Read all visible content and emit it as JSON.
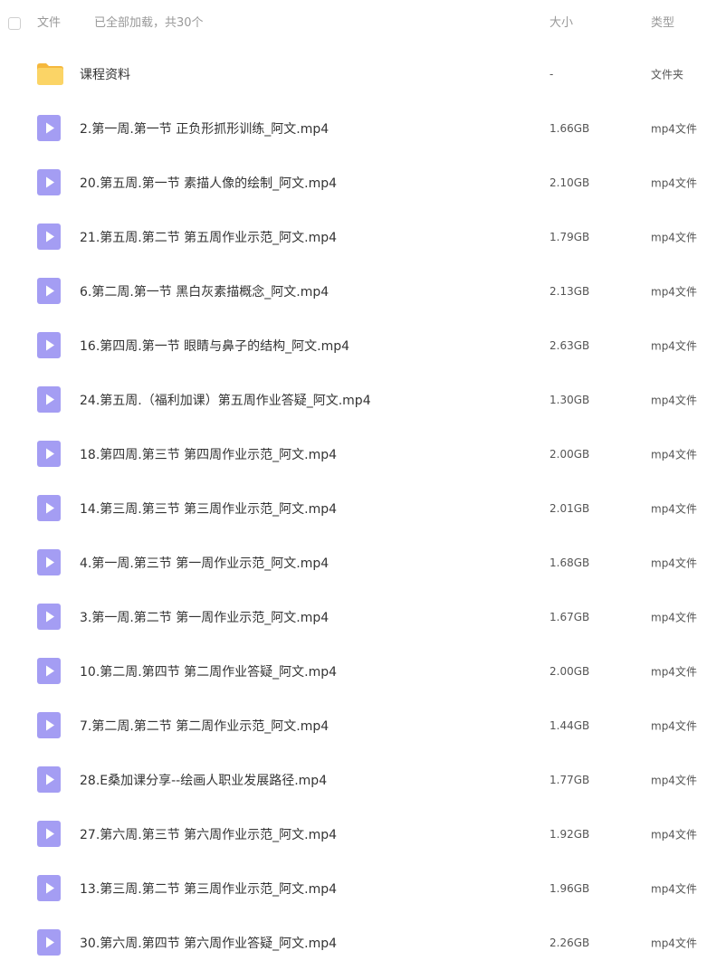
{
  "header": {
    "col_file": "文件",
    "load_status": "已全部加载，共30个",
    "col_size": "大小",
    "col_type": "类型"
  },
  "colors": {
    "video_icon": "#a49df3",
    "folder_icon": "#fbd466",
    "header_text": "#999999"
  },
  "files": [
    {
      "icon": "folder-icon",
      "name": "课程资料",
      "size": "-",
      "type": "文件夹"
    },
    {
      "icon": "video-file-icon",
      "name": "2.第一周.第一节 正负形抓形训练_阿文.mp4",
      "size": "1.66GB",
      "type": "mp4文件"
    },
    {
      "icon": "video-file-icon",
      "name": "20.第五周.第一节 素描人像的绘制_阿文.mp4",
      "size": "2.10GB",
      "type": "mp4文件"
    },
    {
      "icon": "video-file-icon",
      "name": "21.第五周.第二节 第五周作业示范_阿文.mp4",
      "size": "1.79GB",
      "type": "mp4文件"
    },
    {
      "icon": "video-file-icon",
      "name": "6.第二周.第一节 黑白灰素描概念_阿文.mp4",
      "size": "2.13GB",
      "type": "mp4文件"
    },
    {
      "icon": "video-file-icon",
      "name": "16.第四周.第一节 眼睛与鼻子的结构_阿文.mp4",
      "size": "2.63GB",
      "type": "mp4文件"
    },
    {
      "icon": "video-file-icon",
      "name": "24.第五周.（福利加课）第五周作业答疑_阿文.mp4",
      "size": "1.30GB",
      "type": "mp4文件"
    },
    {
      "icon": "video-file-icon",
      "name": "18.第四周.第三节 第四周作业示范_阿文.mp4",
      "size": "2.00GB",
      "type": "mp4文件"
    },
    {
      "icon": "video-file-icon",
      "name": "14.第三周.第三节 第三周作业示范_阿文.mp4",
      "size": "2.01GB",
      "type": "mp4文件"
    },
    {
      "icon": "video-file-icon",
      "name": "4.第一周.第三节 第一周作业示范_阿文.mp4",
      "size": "1.68GB",
      "type": "mp4文件"
    },
    {
      "icon": "video-file-icon",
      "name": "3.第一周.第二节 第一周作业示范_阿文.mp4",
      "size": "1.67GB",
      "type": "mp4文件"
    },
    {
      "icon": "video-file-icon",
      "name": "10.第二周.第四节 第二周作业答疑_阿文.mp4",
      "size": "2.00GB",
      "type": "mp4文件"
    },
    {
      "icon": "video-file-icon",
      "name": "7.第二周.第二节 第二周作业示范_阿文.mp4",
      "size": "1.44GB",
      "type": "mp4文件"
    },
    {
      "icon": "video-file-icon",
      "name": "28.E桑加课分享--绘画人职业发展路径.mp4",
      "size": "1.77GB",
      "type": "mp4文件"
    },
    {
      "icon": "video-file-icon",
      "name": "27.第六周.第三节 第六周作业示范_阿文.mp4",
      "size": "1.92GB",
      "type": "mp4文件"
    },
    {
      "icon": "video-file-icon",
      "name": "13.第三周.第二节 第三周作业示范_阿文.mp4",
      "size": "1.96GB",
      "type": "mp4文件"
    },
    {
      "icon": "video-file-icon",
      "name": "30.第六周.第四节 第六周作业答疑_阿文.mp4",
      "size": "2.26GB",
      "type": "mp4文件"
    }
  ]
}
